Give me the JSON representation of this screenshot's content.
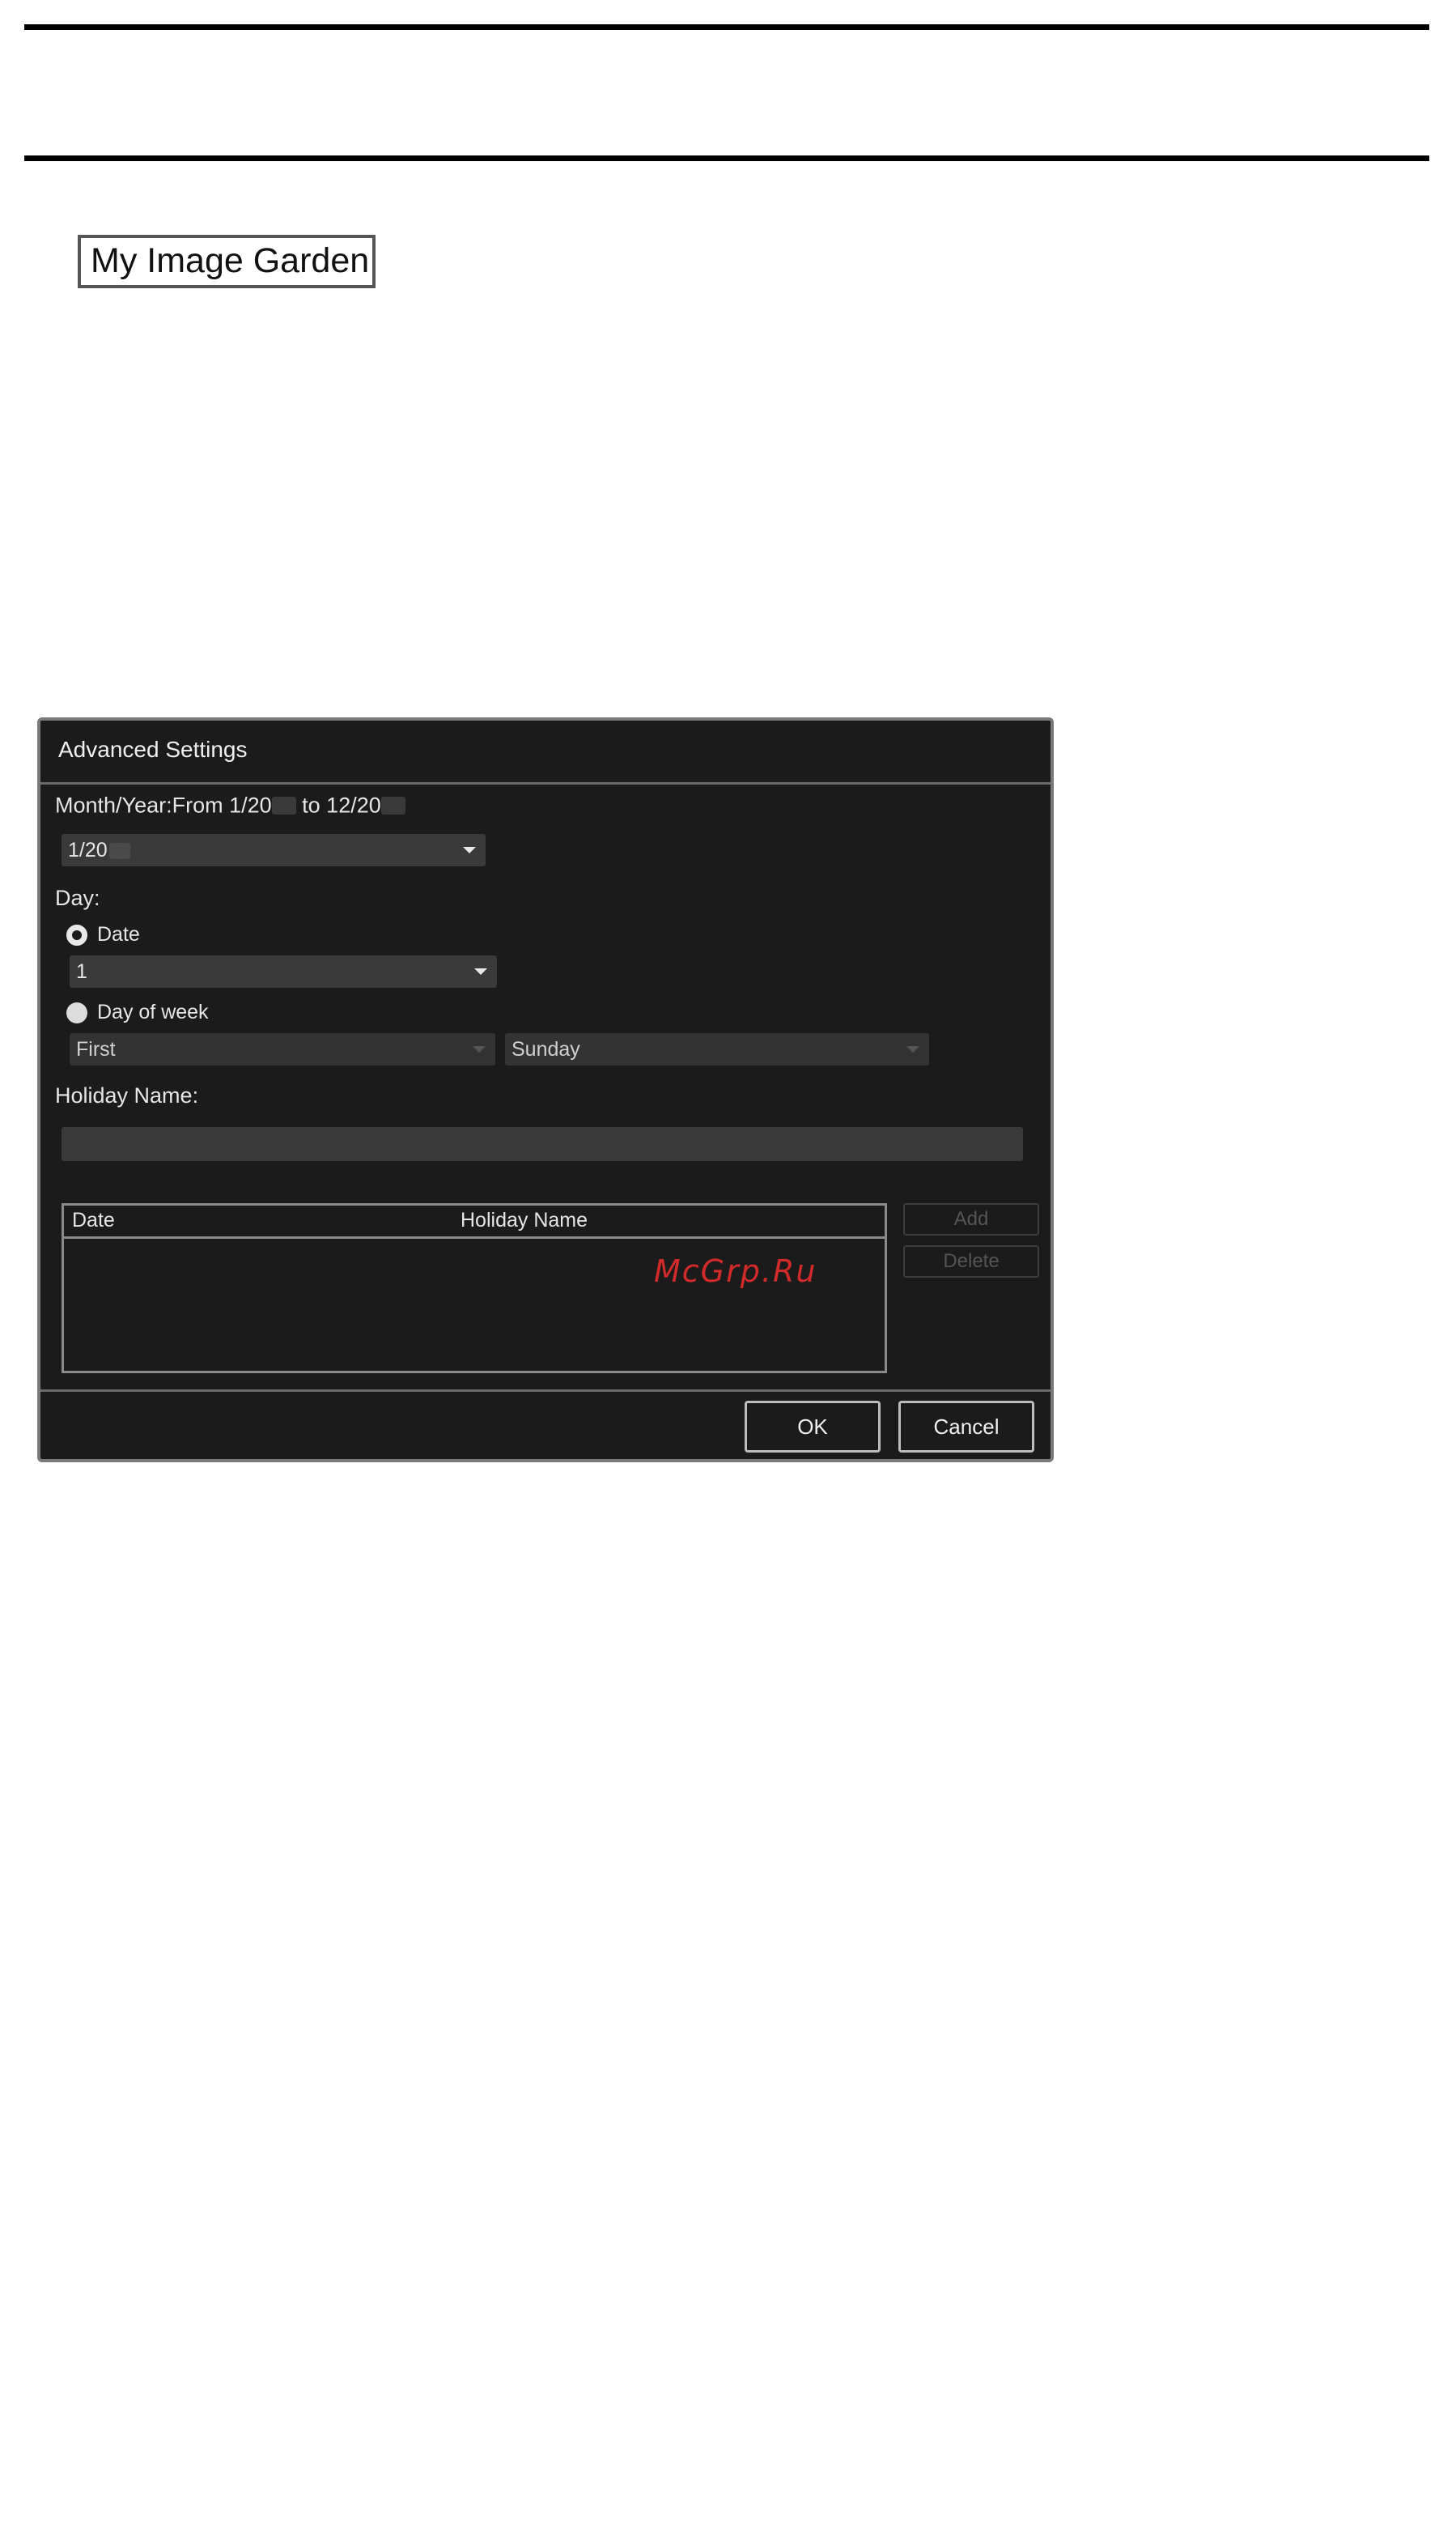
{
  "header": {
    "app_name": "My Image Garden"
  },
  "dialog": {
    "title": "Advanced Settings",
    "month_year_label_a": "Month/Year:From 1/20",
    "month_year_label_b": "to 12/20",
    "month_select_value": "1/20",
    "day_label": "Day:",
    "date_radio_label": "Date",
    "date_radio_selected": true,
    "date_select_value": "1",
    "dow_radio_label": "Day of week",
    "dow_radio_selected": false,
    "week_select_value": "First",
    "weekday_select_value": "Sunday",
    "holiday_name_label": "Holiday Name:",
    "holiday_name_value": "",
    "table": {
      "columns": [
        "Date",
        "Holiday Name"
      ],
      "rows": []
    },
    "add_label": "Add",
    "delete_label": "Delete",
    "ok_label": "OK",
    "cancel_label": "Cancel"
  },
  "watermark": "McGrp.Ru",
  "colors": {
    "dialog_bg": "#1b1b1b",
    "field_bg": "#3a3a3a",
    "watermark": "#d12a2a"
  }
}
